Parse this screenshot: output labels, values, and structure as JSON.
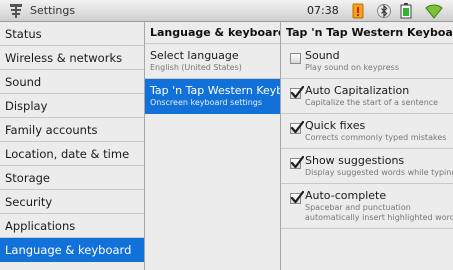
{
  "status_bar": {
    "title": "Settings",
    "time": "07:38",
    "icons": [
      "settings-icon",
      "battery-warning-icon",
      "bluetooth-icon",
      "battery-icon",
      "wifi-icon"
    ]
  },
  "categories": [
    {
      "label": "Status"
    },
    {
      "label": "Wireless & networks"
    },
    {
      "label": "Sound"
    },
    {
      "label": "Display"
    },
    {
      "label": "Family accounts"
    },
    {
      "label": "Location, date & time"
    },
    {
      "label": "Storage"
    },
    {
      "label": "Security"
    },
    {
      "label": "Applications"
    },
    {
      "label": "Language & keyboard",
      "selected": true
    }
  ],
  "middle": {
    "header": "Language & keyboard",
    "items": [
      {
        "title": "Select language",
        "subtitle": "English (United States)"
      },
      {
        "title": "Tap 'n Tap Western Keyboard",
        "subtitle": "Onscreen keyboard settings",
        "selected": true
      }
    ]
  },
  "right": {
    "header": "Tap 'n Tap Western Keyboard",
    "options": [
      {
        "title": "Sound",
        "subtitle": "Play sound on keypress",
        "checked": false
      },
      {
        "title": "Auto Capitalization",
        "subtitle": "Capitalize the start of a sentence",
        "checked": true
      },
      {
        "title": "Quick fixes",
        "subtitle": "Corrects commonly typed mistakes",
        "checked": true
      },
      {
        "title": "Show suggestions",
        "subtitle": "Display suggested words while typing",
        "checked": true
      },
      {
        "title": "Auto-complete",
        "subtitle": "Spacebar and punctuation",
        "subtitle2": "automatically insert highlighted word",
        "checked": true
      }
    ]
  },
  "colors": {
    "selection": "#1271d8",
    "panel": "#ececec"
  }
}
